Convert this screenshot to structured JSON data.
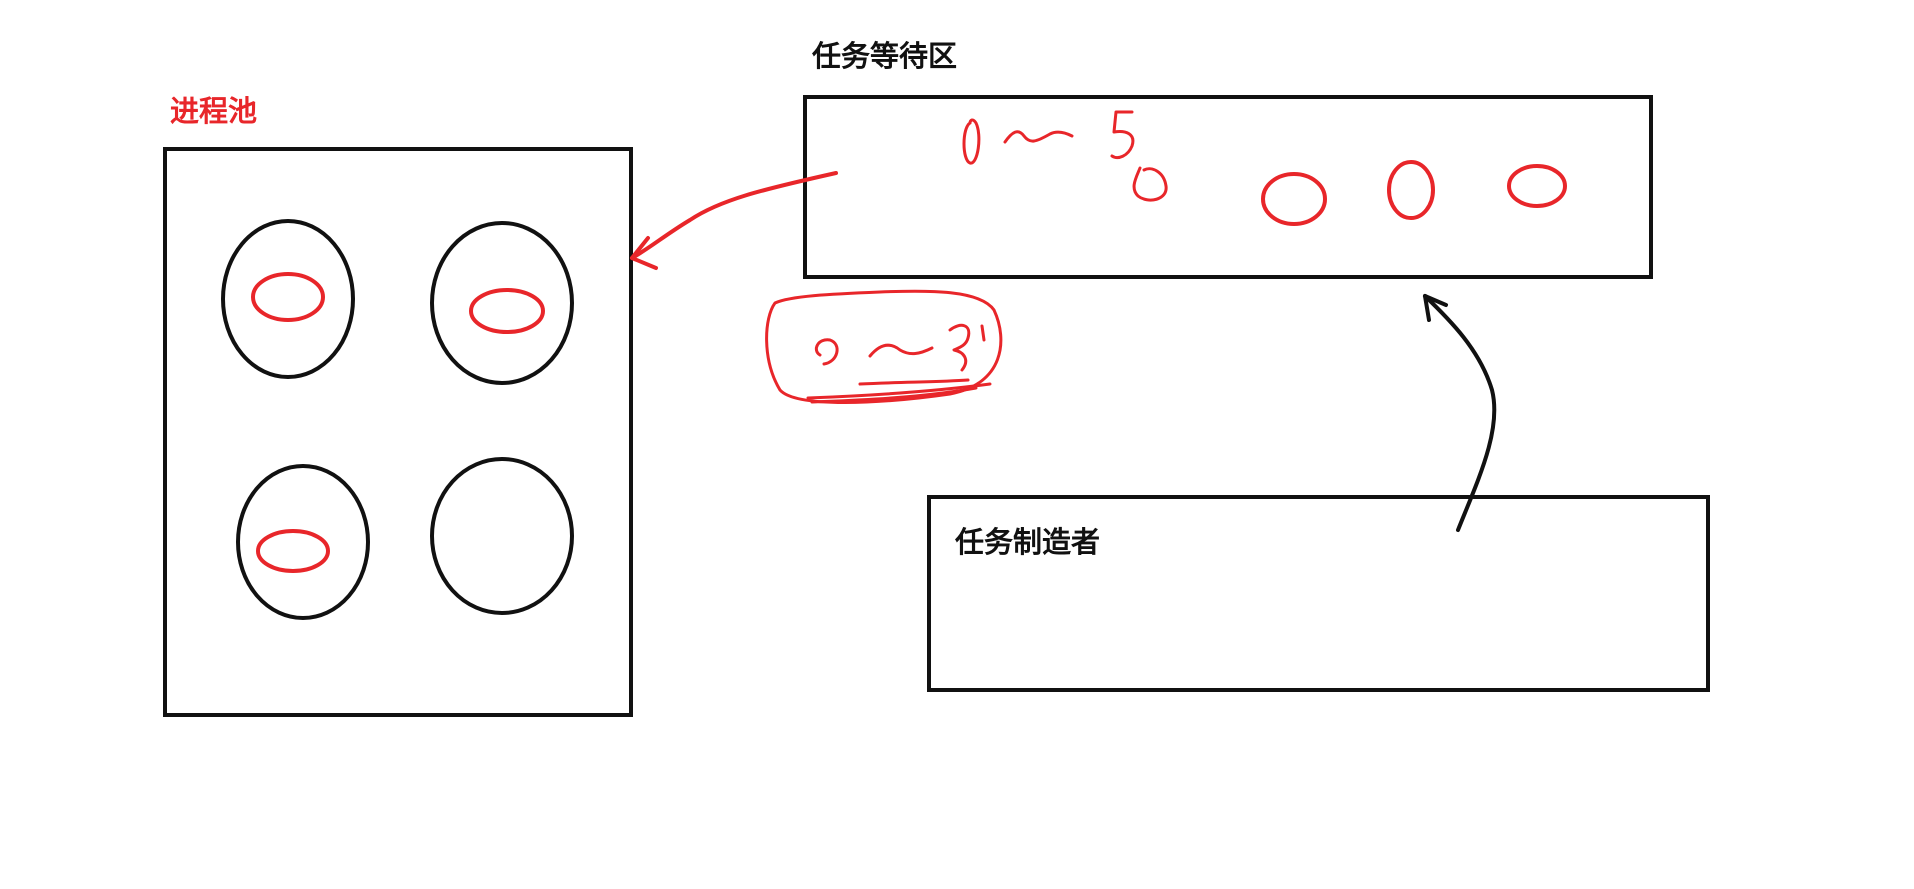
{
  "diagram": {
    "colors": {
      "ink": "#111111",
      "accent": "#e8262a",
      "background": "#ffffff"
    },
    "process_pool": {
      "label": "进程池",
      "worker_slots": [
        {
          "busy": true
        },
        {
          "busy": true
        },
        {
          "busy": true
        },
        {
          "busy": false
        }
      ]
    },
    "task_queue": {
      "label": "任务等待区",
      "queued_tasks": 3
    },
    "task_producer": {
      "label": "任务制造者"
    },
    "arrows": [
      {
        "from": "task_queue",
        "to": "process_pool",
        "color": "accent"
      },
      {
        "from": "task_producer",
        "to": "task_queue",
        "color": "ink"
      }
    ]
  }
}
